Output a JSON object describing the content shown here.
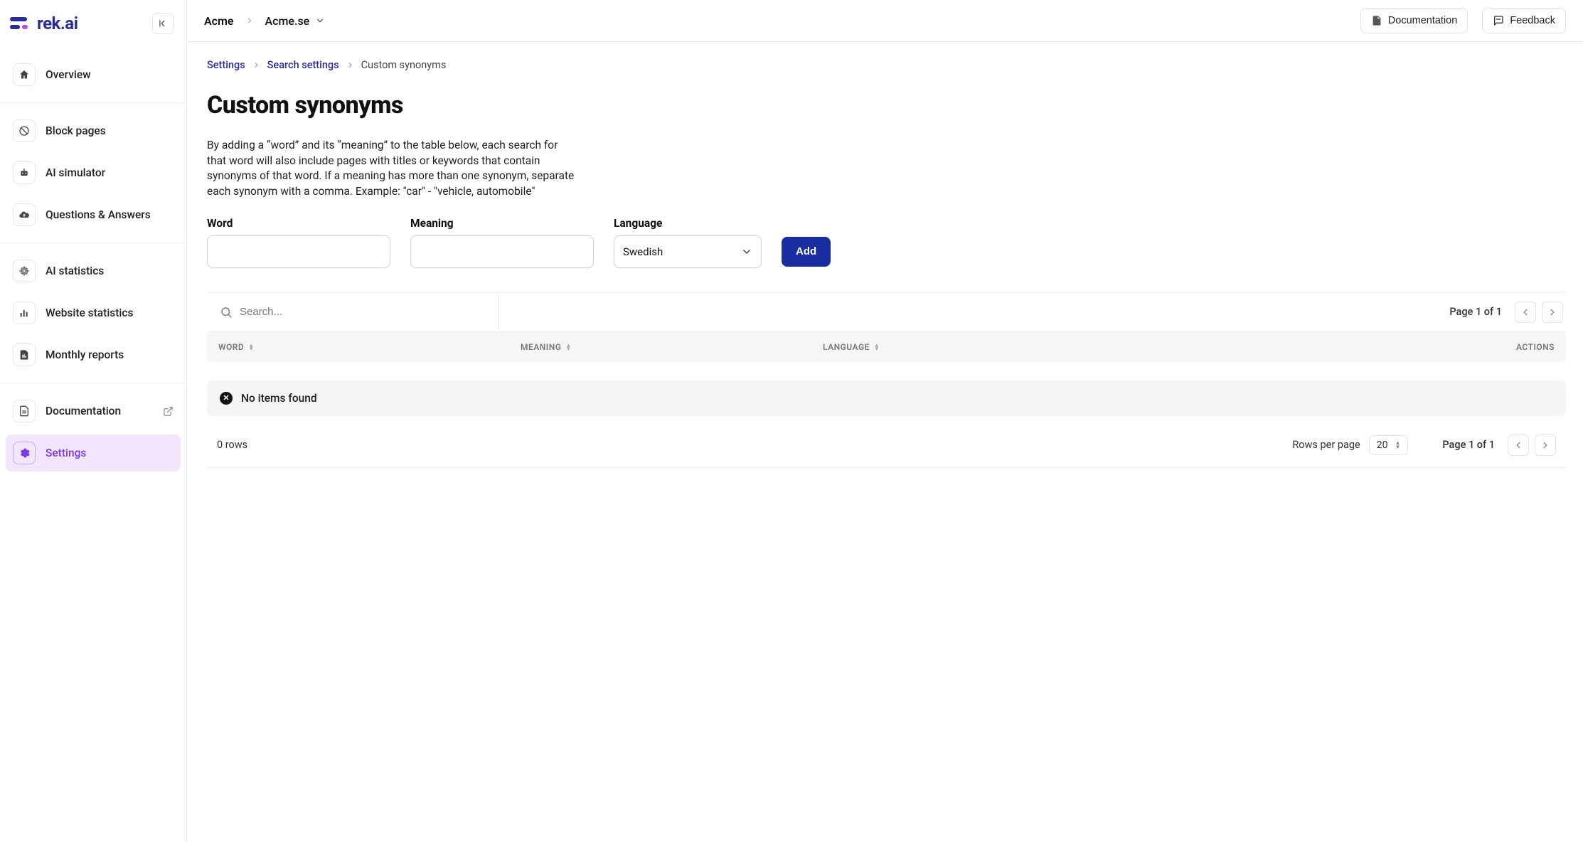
{
  "brand": {
    "name": "rek.ai"
  },
  "sidebar": {
    "groups": [
      {
        "items": [
          {
            "label": "Overview",
            "icon": "home"
          }
        ]
      },
      {
        "items": [
          {
            "label": "Block pages",
            "icon": "block"
          },
          {
            "label": "AI simulator",
            "icon": "robot"
          },
          {
            "label": "Questions & Answers",
            "icon": "cloud"
          }
        ]
      },
      {
        "items": [
          {
            "label": "AI statistics",
            "icon": "chip"
          },
          {
            "label": "Website statistics",
            "icon": "bar-chart"
          },
          {
            "label": "Monthly reports",
            "icon": "report"
          }
        ]
      },
      {
        "items": [
          {
            "label": "Documentation",
            "icon": "doc",
            "external": true
          },
          {
            "label": "Settings",
            "icon": "gear",
            "active": true
          }
        ]
      }
    ]
  },
  "topbar": {
    "org": "Acme",
    "site": "Acme.se",
    "documentation": "Documentation",
    "feedback": "Feedback"
  },
  "breadcrumb": {
    "settings": "Settings",
    "search_settings": "Search settings",
    "current": "Custom synonyms"
  },
  "page": {
    "title": "Custom synonyms",
    "description": "By adding a “word” and its “meaning” to the table below, each search for that word will also include pages with titles or keywords that contain synonyms of that word. If a meaning has more than one synonym, separate each synonym with a comma. Example: \"car\" - \"vehicle, automobile\""
  },
  "form": {
    "word_label": "Word",
    "meaning_label": "Meaning",
    "language_label": "Language",
    "language_value": "Swedish",
    "add_label": "Add"
  },
  "table": {
    "search_placeholder": "Search...",
    "page_indicator_top": "Page 1 of 1",
    "columns": {
      "word": "WORD",
      "meaning": "MEANING",
      "language": "LANGUAGE",
      "actions": "ACTIONS"
    },
    "empty_message": "No items found",
    "rows_count": "0 rows",
    "rows_per_page_label": "Rows per page",
    "rows_per_page_value": "20",
    "page_indicator_bottom": "Page 1 of 1"
  }
}
